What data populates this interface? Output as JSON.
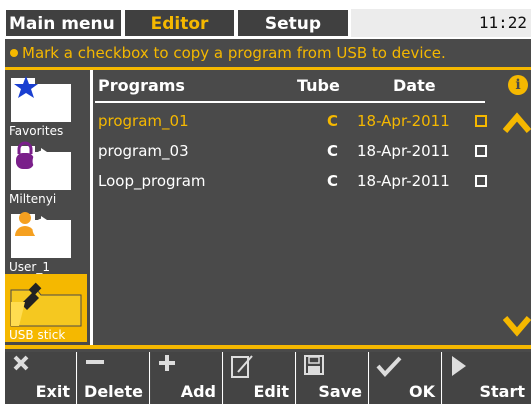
{
  "tabs": {
    "main_menu": "Main menu",
    "editor": "Editor",
    "setup": "Setup"
  },
  "clock": "11:22",
  "banner": "Mark a checkbox to copy a program from USB to device.",
  "sidebar": {
    "items": [
      {
        "label": "Favorites",
        "icon": "star-folder-icon"
      },
      {
        "label": "Miltenyi",
        "icon": "lock-refresh-icon"
      },
      {
        "label": "User_1",
        "icon": "user-refresh-icon"
      },
      {
        "label": "USB stick",
        "icon": "usb-folder-icon",
        "selected": true
      }
    ]
  },
  "table": {
    "headers": {
      "programs": "Programs",
      "tube": "Tube",
      "date": "Date"
    },
    "rows": [
      {
        "name": "program_01",
        "tube": "C",
        "date": "18-Apr-2011",
        "selected": true
      },
      {
        "name": "program_03",
        "tube": "C",
        "date": "18-Apr-2011",
        "selected": false
      },
      {
        "name": "Loop_program",
        "tube": "C",
        "date": "18-Apr-2011",
        "selected": false
      }
    ]
  },
  "info_icon": "i",
  "toolbar": {
    "exit": "Exit",
    "delete": "Delete",
    "add": "Add",
    "edit": "Edit",
    "save": "Save",
    "ok": "OK",
    "start": "Start"
  },
  "colors": {
    "accent": "#f5b800",
    "background": "#4a4a4a",
    "text": "#ffffff"
  }
}
